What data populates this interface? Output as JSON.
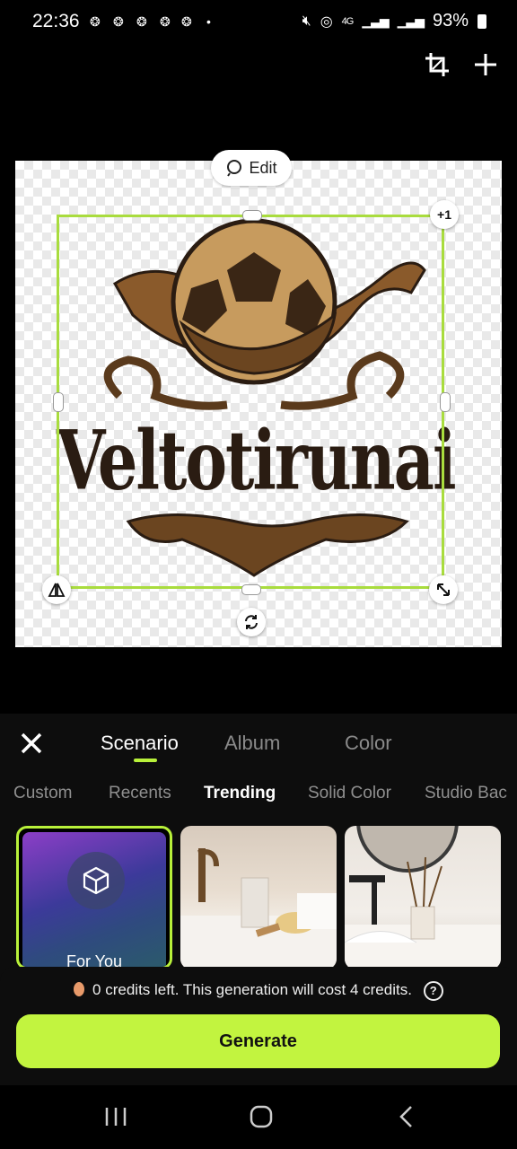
{
  "status_bar": {
    "time": "22:36",
    "battery": "93%",
    "network": "4G"
  },
  "canvas": {
    "edit_label": "Edit",
    "layer_badge": "+1",
    "logo_text": "Veltotirunai"
  },
  "panel": {
    "tabs": [
      {
        "label": "Scenario"
      },
      {
        "label": "Album"
      },
      {
        "label": "Color"
      }
    ],
    "subtabs": [
      {
        "label": "Custom"
      },
      {
        "label": "Recents"
      },
      {
        "label": "Trending"
      },
      {
        "label": "Solid Color"
      },
      {
        "label": "Studio Bac"
      }
    ],
    "cards": [
      {
        "label": "For You"
      }
    ]
  },
  "credits": {
    "message": "0 credits left. This generation will cost 4 credits.",
    "generate_label": "Generate"
  },
  "colors": {
    "accent": "#c2f43f",
    "selection": "#a9dc3e"
  }
}
